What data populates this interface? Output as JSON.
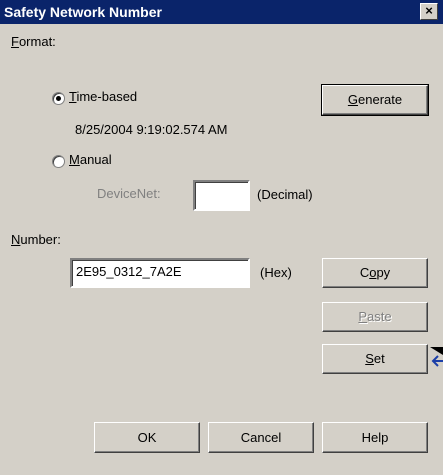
{
  "dialog": {
    "title": "Safety Network Number",
    "close_glyph": "×"
  },
  "format": {
    "label_accel": "F",
    "label_rest": "ormat:",
    "time_based": {
      "label_accel": "T",
      "label_rest": "ime-based",
      "checked": true,
      "timestamp": "8/25/2004 9:19:02.574 AM"
    },
    "manual": {
      "label_accel": "M",
      "label_rest": "anual",
      "checked": false,
      "devicenet_label": "DeviceNet:",
      "devicenet_value": "",
      "unit": "(Decimal)"
    }
  },
  "number": {
    "label_accel": "N",
    "label_rest": "umber:",
    "value": "2E95_0312_7A2E",
    "unit": "(Hex)"
  },
  "buttons": {
    "generate": {
      "accel": "G",
      "rest": "enerate"
    },
    "copy": {
      "pre": "C",
      "accel": "o",
      "rest": "py"
    },
    "paste": {
      "accel": "P",
      "rest": "aste",
      "enabled": false
    },
    "set": {
      "accel": "S",
      "rest": "et"
    },
    "ok": "OK",
    "cancel": "Cancel",
    "help": "Help"
  },
  "icons": {
    "close": "close-icon",
    "radio_selected": "radio-selected-icon",
    "radio_unselected": "radio-unselected-icon",
    "set_arrow": "set-arrow-icon"
  },
  "colors": {
    "titlebar": "#0a246a",
    "face": "#d4d0c8",
    "disabled_text": "#808080",
    "arrow": "#1c3fa8"
  }
}
